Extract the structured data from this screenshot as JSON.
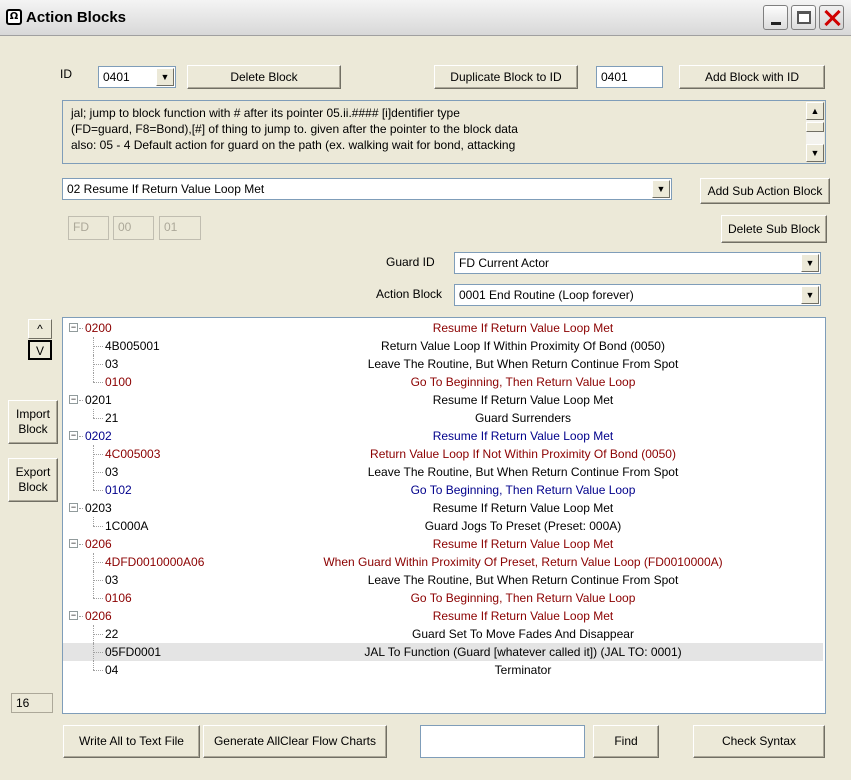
{
  "window": {
    "title": "Action Blocks"
  },
  "top": {
    "id_label": "ID",
    "id_value": "0401",
    "delete_block": "Delete Block",
    "duplicate_block": "Duplicate Block to ID",
    "dup_id_value": "0401",
    "add_block": "Add Block with ID"
  },
  "description": {
    "lines": [
      "jal; jump to block function with # after its pointer 05.ii.#### [i]dentifier type",
      "(FD=guard, F8=Bond),[#] of thing to jump to.  given after the pointer to the block data",
      "also: 05 - 4 Default action for guard on the path (ex. walking wait for bond, attacking"
    ]
  },
  "sub_action": {
    "selected": "02 Resume If Return Value Loop Met",
    "add_label": "Add Sub Action Block",
    "delete_label": "Delete Sub Block",
    "param1": "FD",
    "param2": "00",
    "param3": "01"
  },
  "guard": {
    "label": "Guard ID",
    "value": "FD Current Actor"
  },
  "action_block": {
    "label": "Action Block",
    "value": "0001 End Routine (Loop forever)"
  },
  "side": {
    "up": "^",
    "down": "V",
    "import": [
      "Import",
      "Block"
    ],
    "export": [
      "Export",
      "Block"
    ],
    "count": "16"
  },
  "tree": [
    {
      "code": "0200",
      "desc": "Resume If Return Value Loop Met",
      "level": 0,
      "color": "red"
    },
    {
      "code": "4B005001",
      "desc": "Return Value Loop If Within Proximity Of Bond (0050)",
      "level": 1,
      "color": "black"
    },
    {
      "code": "03",
      "desc": "Leave The Routine, But When Return Continue From Spot",
      "level": 1,
      "color": "black"
    },
    {
      "code": "0100",
      "desc": "Go To Beginning, Then Return Value Loop",
      "level": 1,
      "color": "red"
    },
    {
      "code": "0201",
      "desc": "Resume If Return Value Loop Met",
      "level": 0,
      "color": "black"
    },
    {
      "code": "21",
      "desc": "Guard Surrenders",
      "level": 1,
      "color": "black"
    },
    {
      "code": "0202",
      "desc": "Resume If Return Value Loop Met",
      "level": 0,
      "color": "blue"
    },
    {
      "code": "4C005003",
      "desc": "Return Value Loop If Not Within Proximity Of Bond (0050)",
      "level": 1,
      "color": "red"
    },
    {
      "code": "03",
      "desc": "Leave The Routine, But When Return Continue From Spot",
      "level": 1,
      "color": "black"
    },
    {
      "code": "0102",
      "desc": "Go To Beginning, Then Return Value Loop",
      "level": 1,
      "color": "blue"
    },
    {
      "code": "0203",
      "desc": "Resume If Return Value Loop Met",
      "level": 0,
      "color": "black"
    },
    {
      "code": "1C000A",
      "desc": "Guard Jogs To Preset (Preset: 000A)",
      "level": 1,
      "color": "black"
    },
    {
      "code": "0206",
      "desc": "Resume If Return Value Loop Met",
      "level": 0,
      "color": "red"
    },
    {
      "code": "4DFD0010000A06",
      "desc": "When Guard Within Proximity Of Preset, Return Value Loop (FD0010000A)",
      "level": 1,
      "color": "red"
    },
    {
      "code": "03",
      "desc": "Leave The Routine, But When Return Continue From Spot",
      "level": 1,
      "color": "black"
    },
    {
      "code": "0106",
      "desc": "Go To Beginning, Then Return Value Loop",
      "level": 1,
      "color": "red"
    },
    {
      "code": "0206",
      "desc": "Resume If Return Value Loop Met",
      "level": 0,
      "color": "red"
    },
    {
      "code": "22",
      "desc": "Guard Set To Move Fades And Disappear",
      "level": 1,
      "color": "black"
    },
    {
      "code": "05FD0001",
      "desc": "JAL To Function (Guard [whatever called it]) (JAL TO: 0001)",
      "level": 1,
      "color": "black",
      "selected": true
    },
    {
      "code": "04",
      "desc": "Terminator",
      "level": 1,
      "color": "black"
    }
  ],
  "bottom": {
    "write_all": "Write All to Text File",
    "generate": "Generate AllClear Flow Charts",
    "search_value": "",
    "find": "Find",
    "check_syntax": "Check Syntax"
  },
  "icons": {
    "app": "app-icon",
    "dropdown": "chevron-down-icon",
    "scroll_up": "scroll-up-icon",
    "scroll_down": "scroll-down-icon"
  }
}
